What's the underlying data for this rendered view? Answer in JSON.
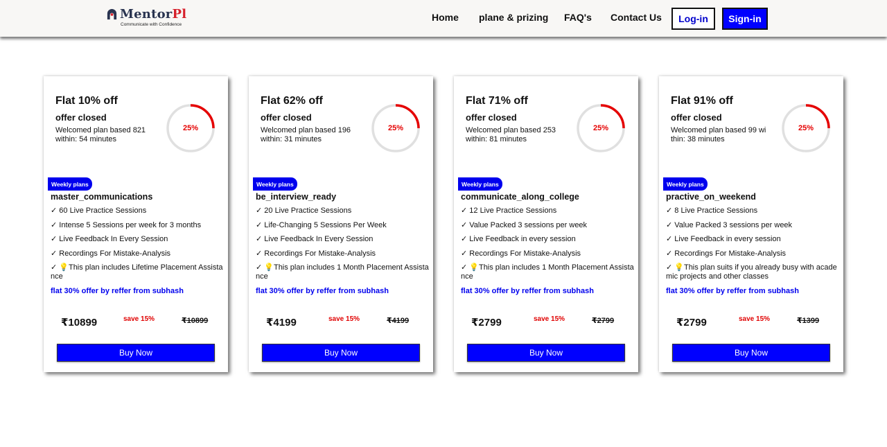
{
  "brand": {
    "name_part1": "Mentor",
    "name_part2": "Pl",
    "tagline": "Communicate with Confidence",
    "colors": {
      "dark": "#2a3450",
      "red": "#d6202b"
    }
  },
  "nav": {
    "links": [
      "Home",
      "plane & prizing",
      "FAQ's",
      "Contact Us"
    ],
    "login": "Log-in",
    "signin": "Sign-in"
  },
  "colors": {
    "accent": "#0000ff",
    "ring": "#e50000",
    "ring_track": "#e0e0e0",
    "save": "#e00000"
  },
  "cards": [
    {
      "title": "Flat 10% off",
      "status": "offer closed",
      "desc": "Welcomed plan based 821 within: 54 minutes",
      "progress": "25%",
      "badge": "Weekly plans",
      "plan": "master_communications",
      "features": [
        "✓ 60 Live Practice Sessions",
        "✓ Intense 5 Sessions per week for 3 months",
        "✓ Live Feedback In Every Session",
        "✓ Recordings For Mistake-Analysis",
        "✓ 💡This plan includes Lifetime Placement Assistance"
      ],
      "offer": "flat 30% offer by reffer from subhash",
      "price": "₹10899",
      "save": "save 15%",
      "old_price": "₹10899",
      "button": "Buy Now"
    },
    {
      "title": "Flat 62% off",
      "status": "offer closed",
      "desc": "Welcomed plan based 196 within: 31 minutes",
      "progress": "25%",
      "badge": "Weekly plans",
      "plan": "be_interview_ready",
      "features": [
        "✓ 20 Live Practice Sessions",
        "✓ Life-Changing 5 Sessions Per Week",
        "✓ Live Feedback In Every Session",
        "✓ Recordings For Mistake-Analysis",
        "✓ 💡This plan includes 1 Month Placement Assistance"
      ],
      "offer": "flat 30% offer by reffer from subhash",
      "price": "₹4199",
      "save": "save 15%",
      "old_price": "₹4199",
      "button": "Buy Now"
    },
    {
      "title": "Flat 71% off",
      "status": "offer closed",
      "desc": "Welcomed plan based 253 within: 81 minutes",
      "progress": "25%",
      "badge": "Weekly plans",
      "plan": "communicate_along_college",
      "features": [
        "✓ 12 Live Practice Sessions",
        "✓ Value Packed 3 sessions per week",
        "✓ Live Feedback in every session",
        "✓ Recordings For Mistake-Analysis",
        "✓ 💡This plan includes 1 Month Placement Assistance"
      ],
      "offer": "flat 30% offer by reffer from subhash",
      "price": "₹2799",
      "save": "save 15%",
      "old_price": "₹2799",
      "button": "Buy Now"
    },
    {
      "title": "Flat 91% off",
      "status": "offer closed",
      "desc": "Welcomed plan based 99 within: 38 minutes",
      "progress": "25%",
      "badge": "Weekly plans",
      "plan": "practive_on_weekend",
      "features": [
        "✓ 8 Live Practice Sessions",
        "✓ Value Packed 3 sessions per week",
        "✓ Live Feedback in every session",
        "✓ Recordings For Mistake-Analysis",
        "✓ 💡This plan suits if you already busy with academic projects and other classes"
      ],
      "offer": "flat 30% offer by reffer from subhash",
      "price": "₹2799",
      "save": "save 15%",
      "old_price": "₹1399",
      "button": "Buy Now"
    }
  ]
}
